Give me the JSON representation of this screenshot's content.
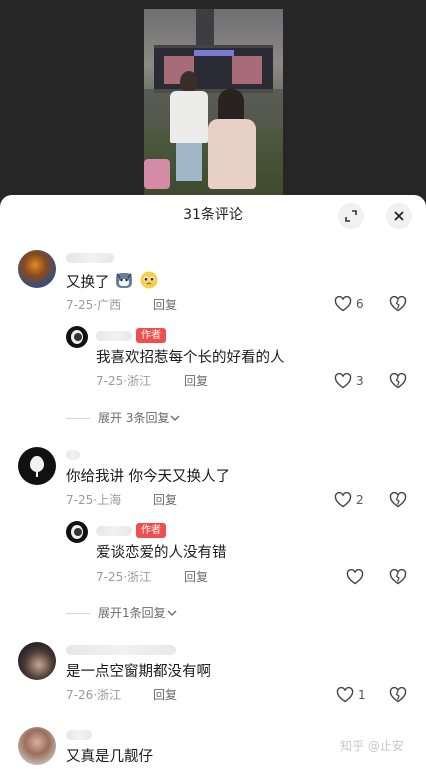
{
  "sheet": {
    "title": "31条评论"
  },
  "comments": [
    {
      "text": "又换了",
      "emojis": [
        "husky-emoji",
        "pleading-face-emoji"
      ],
      "date": "7-25",
      "location": "广西",
      "reply_label": "回复",
      "likes": "6",
      "replies": [
        {
          "author_tag": "作者",
          "text": "我喜欢招惹每个长的好看的人",
          "date": "7-25",
          "location": "浙江",
          "reply_label": "回复",
          "likes": "3"
        }
      ],
      "expand_label": "展开 3条回复"
    },
    {
      "text": "你给我讲 你今天又换人了",
      "date": "7-25",
      "location": "上海",
      "reply_label": "回复",
      "likes": "2",
      "replies": [
        {
          "author_tag": "作者",
          "text": "爱谈恋爱的人没有错",
          "date": "7-25",
          "location": "浙江",
          "reply_label": "回复",
          "likes": ""
        }
      ],
      "expand_label": "展开1条回复"
    },
    {
      "text": "是一点空窗期都没有啊",
      "date": "7-26",
      "location": "浙江",
      "reply_label": "回复",
      "likes": "1"
    },
    {
      "text": "又真是几靓仔"
    }
  ],
  "meta_separator": "·",
  "watermark": "知乎 @止安",
  "colors": {
    "author_tag": "#ef4f4f",
    "meta_text": "#9b9b9b",
    "sheet_bg": "#ffffff"
  }
}
